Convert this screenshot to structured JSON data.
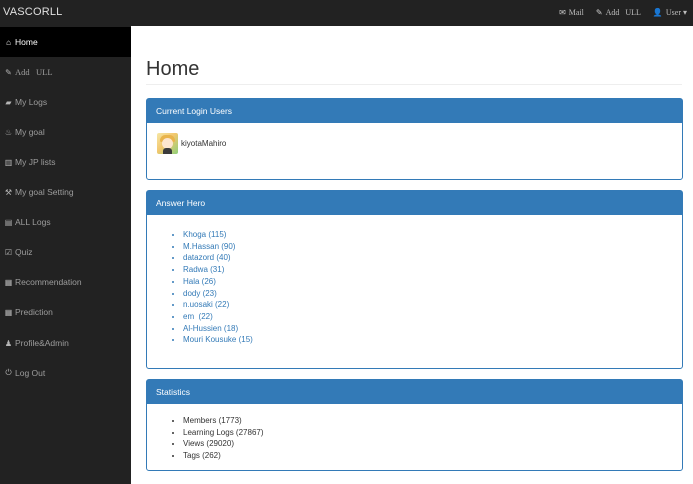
{
  "navbar": {
    "brand": "VASCORLL",
    "links": [
      {
        "icon": "envelope-icon",
        "glyph": "✉",
        "label": "Mail"
      },
      {
        "icon": "pencil-icon",
        "glyph": "✎",
        "label": "Add   ULL"
      },
      {
        "icon": "user-icon",
        "glyph": "👤",
        "label": "User ▾"
      }
    ]
  },
  "sidebar": {
    "items": [
      {
        "icon": "home-icon",
        "glyph": "⌂",
        "label": "Home",
        "active": true
      },
      {
        "icon": "pencil-icon",
        "glyph": "✎",
        "label": "Add   ULL"
      },
      {
        "icon": "folder-icon",
        "glyph": "▰",
        "label": "My Logs"
      },
      {
        "icon": "fire-icon",
        "glyph": "♨",
        "label": "My goal"
      },
      {
        "icon": "bar-chart-icon",
        "glyph": "▥",
        "label": "My JP lists"
      },
      {
        "icon": "wrench-icon",
        "glyph": "⚒",
        "label": "My goal Setting"
      },
      {
        "icon": "list-icon",
        "glyph": "▤",
        "label": "ALL Logs"
      },
      {
        "icon": "check-square-icon",
        "glyph": "☑",
        "label": "Quiz"
      },
      {
        "icon": "grid-icon",
        "glyph": "▦",
        "label": "Recommendation"
      },
      {
        "icon": "grid-icon",
        "glyph": "▦",
        "label": "Prediction"
      },
      {
        "icon": "person-icon",
        "glyph": "♟",
        "label": "Profile&Admin"
      },
      {
        "icon": "power-icon",
        "glyph": "⏻",
        "label": "Log Out"
      }
    ]
  },
  "main": {
    "title": "Home",
    "current_users": {
      "heading": "Current Login Users",
      "users": [
        {
          "name": "kiyotaMahiro"
        }
      ]
    },
    "answer_hero": {
      "heading": "Answer Hero",
      "items": [
        "Khoga (115)",
        "M.Hassan (90)",
        "datazord (40)",
        "Radwa (31)",
        "Hala (26)",
        "dody (23)",
        "n.uosaki (22)",
        "em  (22)",
        "Al-Hussien (18)",
        "Mouri Kousuke (15)"
      ]
    },
    "statistics": {
      "heading": "Statistics",
      "items": [
        "Members (1773)",
        "Learning Logs (27867)",
        "Views (29020)",
        "Tags (262)"
      ]
    }
  },
  "colors": {
    "navbar_bg": "#222222",
    "sidebar_active_bg": "#000000",
    "panel_primary": "#337ab7",
    "link": "#337ab7"
  }
}
